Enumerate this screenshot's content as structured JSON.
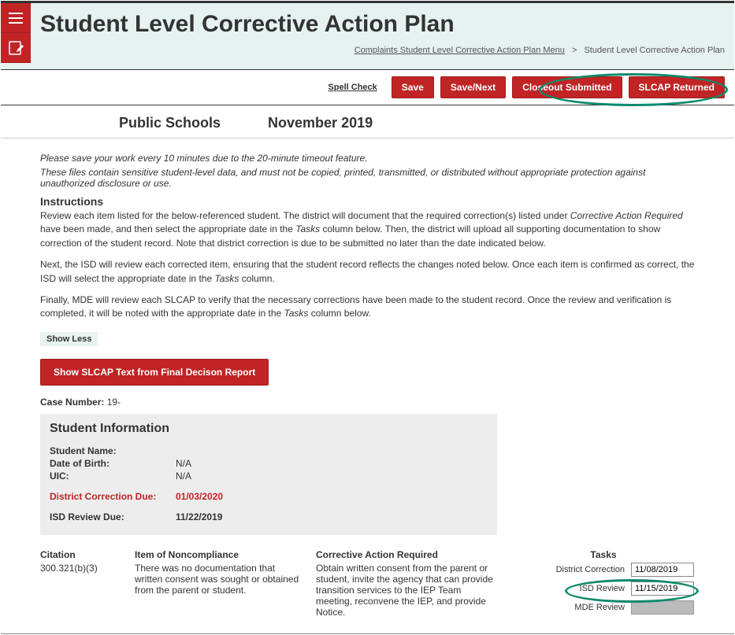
{
  "header": {
    "title": "Student Level Corrective Action Plan",
    "breadcrumb_link": "Complaints Student Level Corrective Action Plan Menu",
    "breadcrumb_sep": ">",
    "breadcrumb_current": "Student Level Corrective Action Plan"
  },
  "actionbar": {
    "spellcheck": "Spell Check",
    "save": "Save",
    "savenext": "Save/Next",
    "closeout": "Closeout Submitted",
    "returned": "SLCAP Returned"
  },
  "subheader": {
    "schools": "Public Schools",
    "period": "November 2019"
  },
  "notes": {
    "note1": "Please save your work every 10 minutes due to the 20-minute timeout feature.",
    "note2": "These files contain sensitive student-level data, and must not be copied, printed, transmitted, or distributed without appropriate protection against unauthorized disclosure or use."
  },
  "instructions": {
    "title": "Instructions",
    "p1a": "Review each item listed for the below-referenced student. The district will document that the required correction(s) listed under ",
    "p1_em": "Corrective Action Required",
    "p1b": " have been made, and then select the appropriate date in the ",
    "p1_em2": "Tasks",
    "p1c": " column below. Then, the district will upload all supporting documentation to show correction of the student record. Note that district correction is due to be submitted no later than the date indicated below.",
    "p2a": "Next, the ISD will review each corrected item, ensuring that the student record reflects the changes noted below. Once each item is confirmed as correct, the ISD will select the appropriate date in the ",
    "p2_em": "Tasks",
    "p2b": " column.",
    "p3a": "Finally, MDE will review each SLCAP to verify that the necessary corrections have been made to the student record. Once the review and verification is completed, it will be noted with the appropriate date in the ",
    "p3_em": "Tasks",
    "p3b": " column below."
  },
  "toggles": {
    "show_less": "Show Less",
    "slcap_text_btn": "Show SLCAP Text from Final Decison Report"
  },
  "case": {
    "label": "Case Number:",
    "value": "19-"
  },
  "student": {
    "header": "Student Information",
    "name_label": "Student Name:",
    "name_value": "",
    "dob_label": "Date of Birth:",
    "dob_value": "N/A",
    "uic_label": "UIC:",
    "uic_value": "N/A",
    "dcd_label": "District Correction Due:",
    "dcd_value": "01/03/2020",
    "isd_label": "ISD Review Due:",
    "isd_value": "11/22/2019"
  },
  "citation": {
    "citation_header": "Citation",
    "citation_value": "300.321(b)(3)",
    "noncomp_header": "Item of Noncompliance",
    "noncomp_text": "There was no documentation that written consent was sought or obtained from the parent or student.",
    "corrective_header": "Corrective Action Required",
    "corrective_text": "Obtain written consent from the parent or student, invite the agency that can provide transition services to the IEP Team meeting, reconvene the IEP, and provide Notice.",
    "tasks_header": "Tasks",
    "task_dc_label": "District Correction",
    "task_dc_value": "11/08/2019",
    "task_isd_label": "ISD Review",
    "task_isd_value": "11/15/2019",
    "task_mde_label": "MDE Review",
    "task_mde_value": ""
  }
}
